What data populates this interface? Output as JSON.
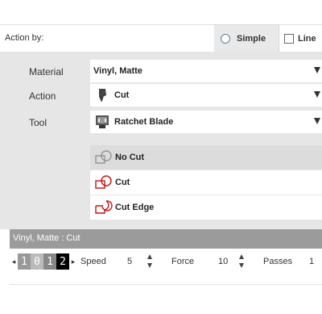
{
  "action_by": {
    "label": "Action by:",
    "options": [
      {
        "label": "Simple",
        "selected": true
      },
      {
        "label": "Line",
        "selected": false
      }
    ]
  },
  "fields": {
    "material": {
      "label": "Material",
      "value": "Vinyl, Matte"
    },
    "action": {
      "label": "Action",
      "value": "Cut"
    },
    "tool": {
      "label": "Tool",
      "value": "Ratchet Blade"
    }
  },
  "cut_options": [
    {
      "label": "No Cut",
      "selected": true,
      "icon": "no-cut-icon"
    },
    {
      "label": "Cut",
      "selected": false,
      "icon": "cut-icon"
    },
    {
      "label": "Cut Edge",
      "selected": false,
      "icon": "cut-edge-icon"
    }
  ],
  "summary": "Vinyl, Matte : Cut",
  "blade_depth": {
    "digits": [
      "1",
      "0",
      "1",
      "2"
    ],
    "left_arrow": "◂",
    "right_arrow": "▸"
  },
  "speed": {
    "label": "Speed",
    "value": "5"
  },
  "force": {
    "label": "Force",
    "value": "10"
  },
  "passes": {
    "label": "Passes",
    "value": "1"
  },
  "colors": {
    "accent_red": "#cc1111",
    "panel_grey": "#e6e6e6",
    "summary_grey": "#9b9b9b"
  }
}
